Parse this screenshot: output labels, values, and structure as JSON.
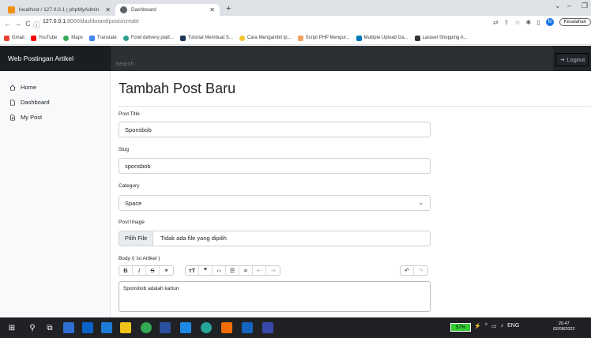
{
  "browser": {
    "tabs": [
      {
        "title": "localhost / 127.0.0.1 | phpMyAdmin",
        "active": false
      },
      {
        "title": "Dashboard",
        "active": true
      }
    ],
    "url_host": "127.0.0.1",
    "url_port": ":8000",
    "url_path": "/dashboard/posts/create",
    "profile_initial": "N",
    "profile_label": "Kesalahan",
    "bookmarks": [
      "Gmail",
      "YouTube",
      "Maps",
      "Translate",
      "Food delivery platf...",
      "Tutorial Membuat S...",
      "Cara Mengambil Ip...",
      "Script PHP Mengur...",
      "Multiple Upload Ga...",
      "Laravel Shopping A..."
    ]
  },
  "navbar": {
    "brand": "Web Postingan Artikel",
    "search_placeholder": "Search",
    "logout_label": "Logout"
  },
  "sidebar": {
    "items": [
      {
        "label": "Home",
        "icon": "home-icon"
      },
      {
        "label": "Dashboard",
        "icon": "file-icon"
      },
      {
        "label": "My Post",
        "icon": "file-text-icon"
      }
    ]
  },
  "main": {
    "heading": "Tambah Post Baru",
    "title_label": "Post Title",
    "title_value": "Sponsbob",
    "slug_label": "Slug",
    "slug_value": "sponsbob",
    "category_label": "Category",
    "category_value": "Space",
    "image_label": "Post Image",
    "file_button": "Pilih File",
    "file_status": "Tidak ada file yang dipilih",
    "body_label": "Body /( Isi Artikel )",
    "body_value": "Sponsbob adalah kartun"
  },
  "taskbar": {
    "battery": "57%",
    "lang": "ENG",
    "time": "20.47",
    "date": "02/08/2022"
  },
  "colors": {
    "navbar_bg": "#212529",
    "primary": "#0d6efd",
    "sidebar_bg": "#f8f9fa"
  }
}
